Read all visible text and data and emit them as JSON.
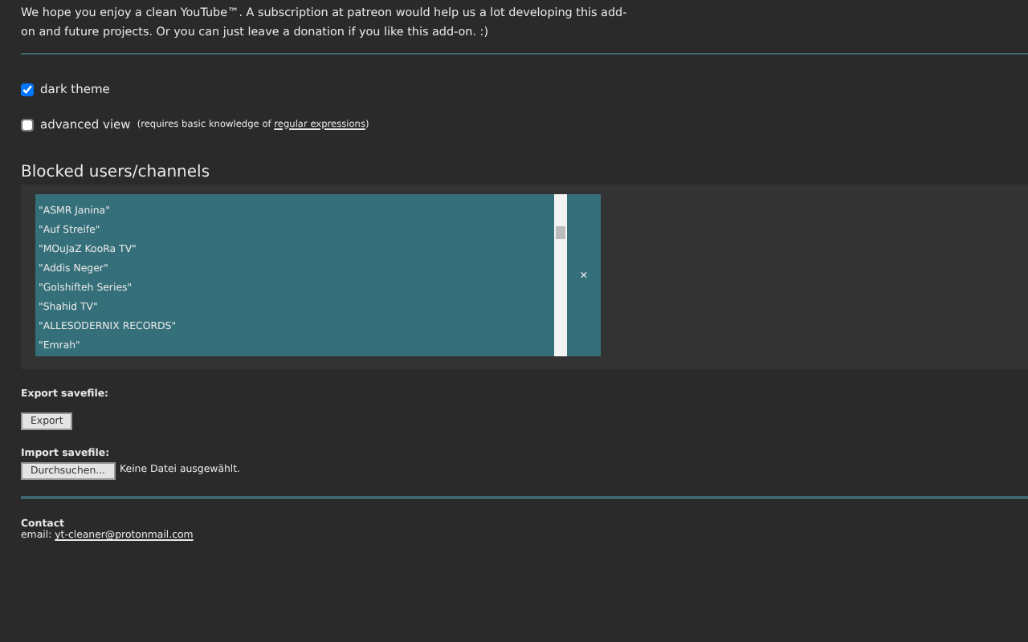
{
  "intro": "We hope you enjoy a clean YouTube™. A subscription at patreon would help us a lot developing this add-on and future projects. Or you can just leave a donation if you like this add-on. :)",
  "options": [
    {
      "label": "dark theme",
      "checked": true
    },
    {
      "label": "advanced view",
      "note": "(requires basic knowledge of ",
      "link": "regular expressions",
      "note_end": ")",
      "checked": false
    }
  ],
  "blocked": {
    "title": "Blocked users/channels",
    "items": [
      "\"ASMR Janina\"",
      "\"Auf Streife\"",
      "\"MOuJaZ KooRa TV\"",
      "\"Addis Neger\"",
      "\"Golshifteh Series\"",
      "\"Shahid TV\"",
      "\"ALLESODERNIX RECORDS\"",
      "\"Emrah\""
    ],
    "clear": "×"
  },
  "export": {
    "label": "Export savefile:",
    "button": "Export"
  },
  "import": {
    "label": "Import savefile:",
    "button": "Durchsuchen...",
    "status": "Keine Datei ausgewählt."
  },
  "contact": {
    "title": "Contact",
    "prefix": "email: ",
    "email": "yt-cleaner@protonmail.com"
  }
}
